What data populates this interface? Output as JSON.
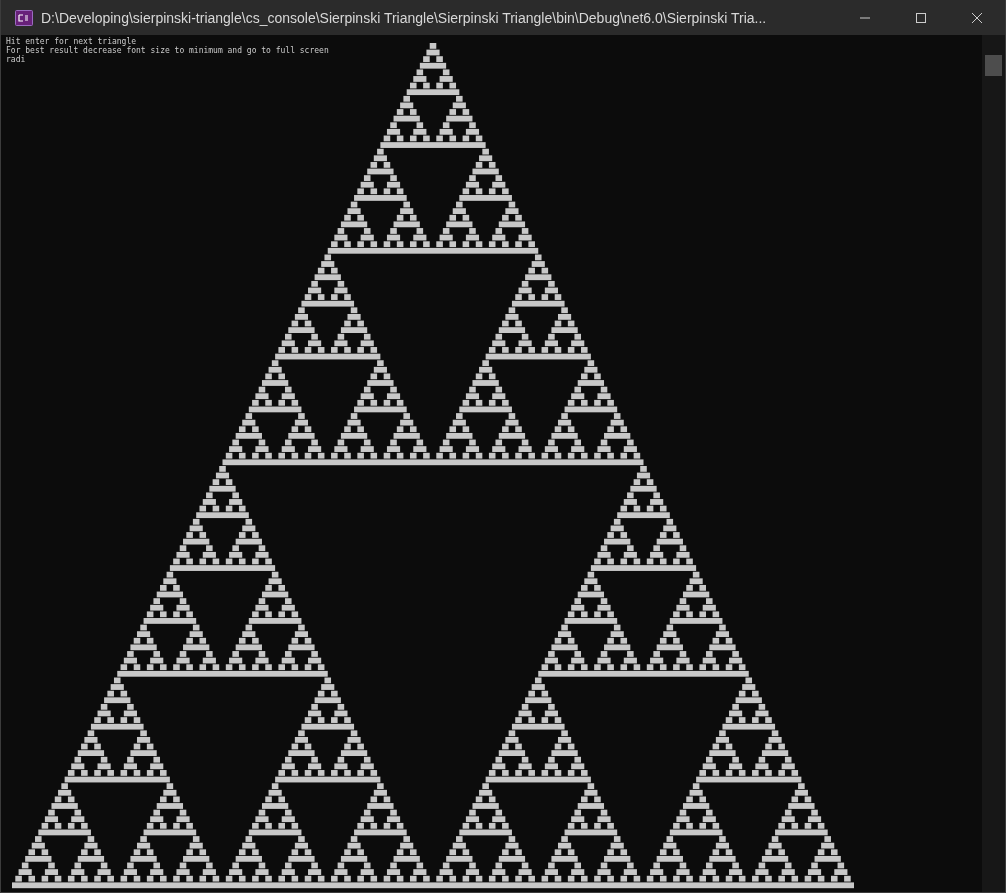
{
  "window": {
    "title": "D:\\Developing\\sierpinski-triangle\\cs_console\\Sierpinski Triangle\\Sierpinski Triangle\\bin\\Debug\\net6.0\\Sierpinski Tria..."
  },
  "console": {
    "lines": [
      "Hit enter for next triangle",
      "For best result decrease font size to minimum and go to full screen",
      "radi"
    ]
  }
}
